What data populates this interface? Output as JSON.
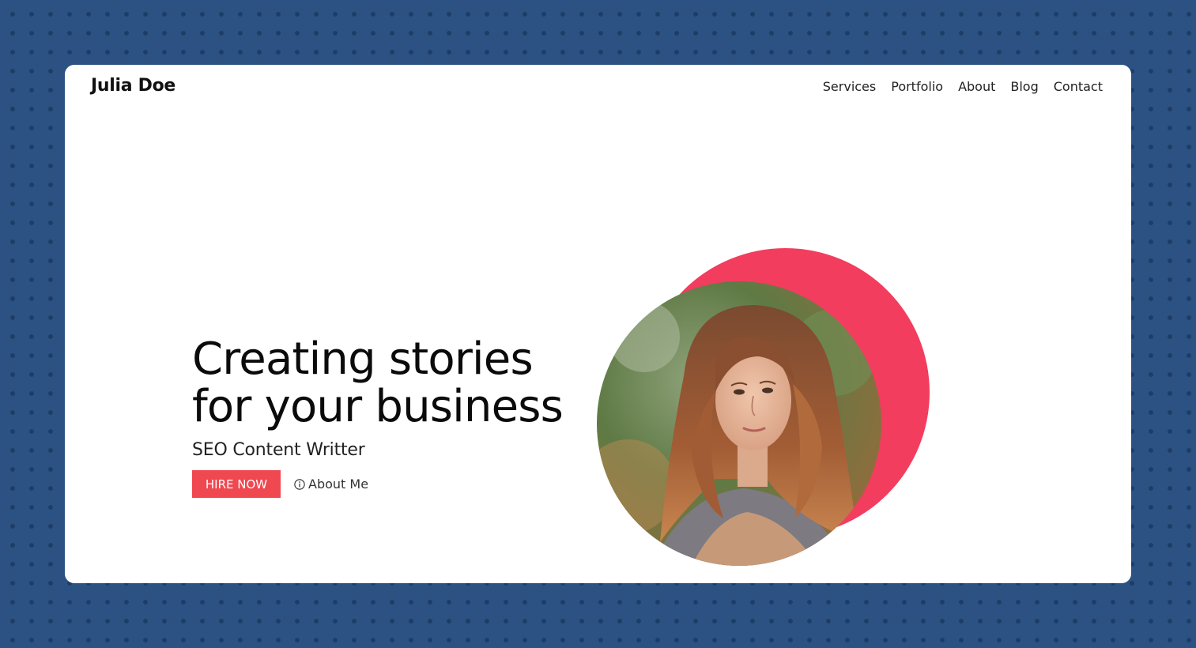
{
  "header": {
    "brand": "Julia Doe",
    "nav": [
      {
        "label": "Services"
      },
      {
        "label": "Portfolio"
      },
      {
        "label": "About"
      },
      {
        "label": "Blog"
      },
      {
        "label": "Contact"
      }
    ]
  },
  "hero": {
    "headline_line1": "Creating stories",
    "headline_line2": "for your business",
    "subheadline": "SEO Content Writter",
    "primary_button": "HIRE NOW",
    "secondary_link": "About Me",
    "secondary_icon": "info-circle-icon"
  },
  "colors": {
    "page_background": "#2b5283",
    "accent": "#ef4850",
    "blob": "#f23d5e"
  }
}
